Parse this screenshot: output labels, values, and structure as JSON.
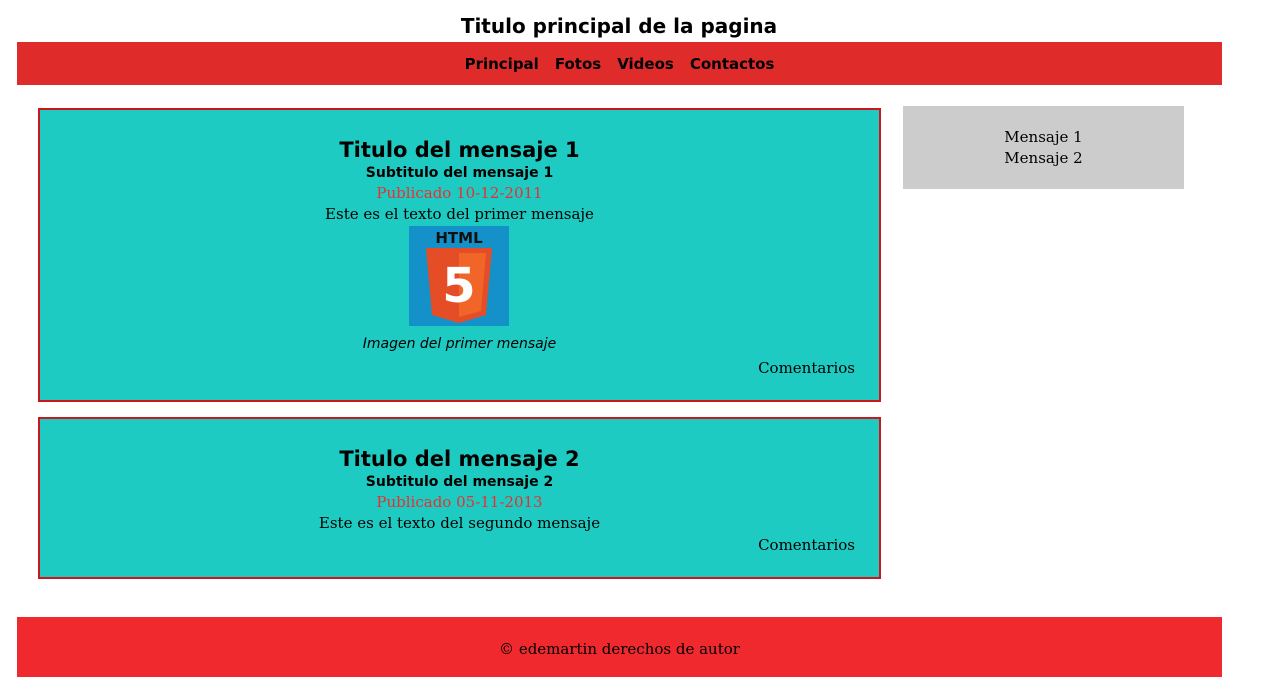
{
  "header": {
    "title": "Titulo principal de la pagina"
  },
  "nav": {
    "items": [
      {
        "label": "Principal"
      },
      {
        "label": "Fotos"
      },
      {
        "label": "Videos"
      },
      {
        "label": "Contactos"
      }
    ]
  },
  "articles": [
    {
      "title": "Titulo del mensaje 1",
      "subtitle": "Subtitulo del mensaje 1",
      "date": "Publicado 10-12-2011",
      "text": "Este es el texto del primer mensaje",
      "image_logo_text": "HTML",
      "image_logo_number": "5",
      "caption": "Imagen del primer mensaje",
      "comments": "Comentarios"
    },
    {
      "title": "Titulo del mensaje 2",
      "subtitle": "Subtitulo del mensaje 2",
      "date": "Publicado 05-11-2013",
      "text": "Este es el texto del segundo mensaje",
      "comments": "Comentarios"
    }
  ],
  "sidebar": {
    "items": [
      {
        "label": "Mensaje 1"
      },
      {
        "label": "Mensaje 2"
      }
    ]
  },
  "footer": {
    "text": "© edemartin derechos de autor"
  },
  "colors": {
    "nav_bg": "#e02b2b",
    "article_bg": "#1ecbc2",
    "article_border": "#d0141c",
    "date_text": "#e83030",
    "sidebar_bg": "#cccccc",
    "footer_bg": "#f0292e"
  }
}
